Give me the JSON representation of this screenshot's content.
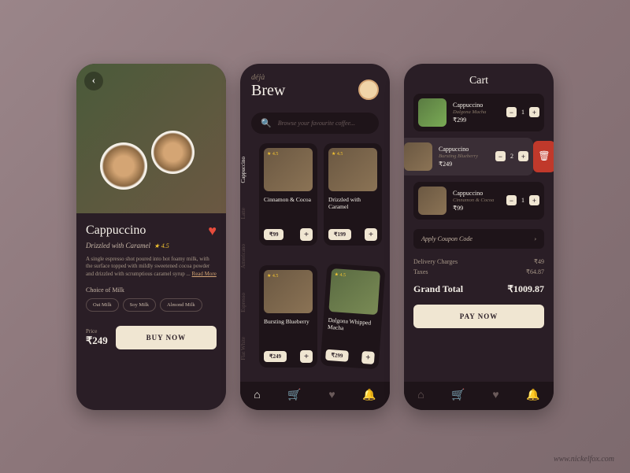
{
  "credit": "www.nickelfox.com",
  "detail": {
    "title": "Cappuccino",
    "subtitle": "Drizzled with Caramel",
    "rating": "★ 4.5",
    "description": "A single espresso shot poured into hot foamy milk, with the surface topped with mildly sweetened cocoa powder and drizzled with scrumptious caramel syrup ... ",
    "readmore": "Read More",
    "milk_label": "Choice of Milk",
    "milks": [
      "Oat Milk",
      "Soy Milk",
      "Almond Milk"
    ],
    "price_label": "Price",
    "price": "₹249",
    "buy": "BUY NOW"
  },
  "home": {
    "brand_sm": "déjà",
    "brand_lg": "Brew",
    "search_placeholder": "Browse your favourite coffee...",
    "tabs": [
      "Cappuccino",
      "Latte",
      "Americano",
      "Espresso",
      "Flat White"
    ],
    "products": [
      {
        "name": "Cinnamon & Cocoa",
        "price": "₹99",
        "rating": "★ 4.5"
      },
      {
        "name": "Drizzled with Caramel",
        "price": "₹199",
        "rating": "★ 4.5"
      },
      {
        "name": "Bursting Blueberry",
        "price": "₹249",
        "rating": "★ 4.5"
      },
      {
        "name": "Dalgona Whipped Macha",
        "price": "₹299",
        "rating": "★ 4.5"
      }
    ]
  },
  "cart": {
    "title": "Cart",
    "items": [
      {
        "name": "Cappuccino",
        "sub": "Dalgona Macha",
        "price": "₹299",
        "qty": "1"
      },
      {
        "name": "Cappuccino",
        "sub": "Bursting Blueberry",
        "price": "₹249",
        "qty": "2"
      },
      {
        "name": "Cappuccino",
        "sub": "Cinnamon & Cocoa",
        "price": "₹99",
        "qty": "1"
      }
    ],
    "coupon": "Apply Coupon Code",
    "delivery_label": "Delivery Charges",
    "delivery": "₹49",
    "tax_label": "Taxes",
    "tax": "₹64.87",
    "total_label": "Grand Total",
    "total": "₹1009.87",
    "pay": "PAY NOW"
  }
}
